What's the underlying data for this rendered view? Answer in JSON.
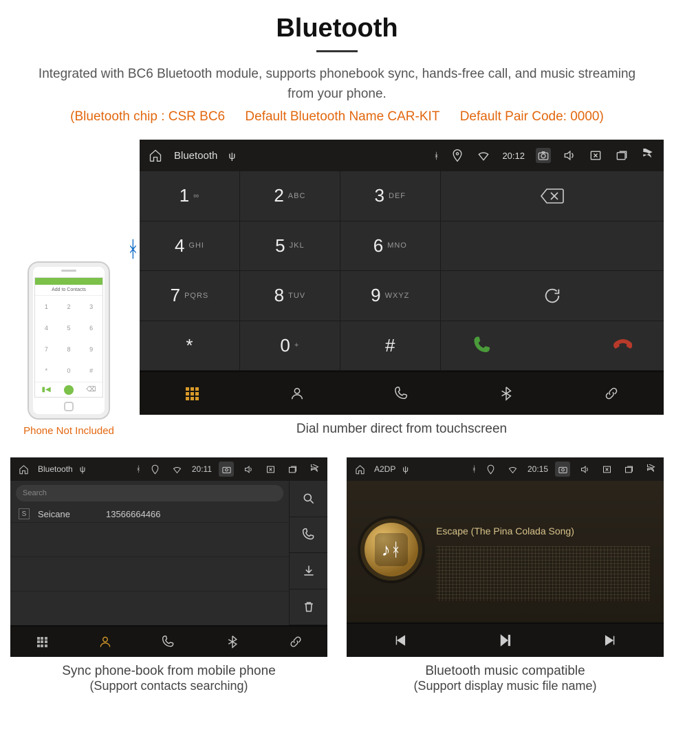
{
  "header": {
    "title": "Bluetooth",
    "subtitle": "Integrated with BC6 Bluetooth module, supports phonebook sync, hands-free call, and music streaming from your phone.",
    "hint_chip": "(Bluetooth chip : CSR BC6",
    "hint_name": "Default Bluetooth Name CAR-KIT",
    "hint_code": "Default Pair Code: 0000)"
  },
  "phone": {
    "add_to_contacts": "Add to Contacts",
    "keys": [
      "1",
      "2",
      "3",
      "4",
      "5",
      "6",
      "7",
      "8",
      "9",
      "*",
      "0",
      "#"
    ],
    "not_included": "Phone Not Included"
  },
  "dialer": {
    "topbar": {
      "title": "Bluetooth",
      "time": "20:12"
    },
    "keys": [
      {
        "n": "1",
        "l": "∞"
      },
      {
        "n": "2",
        "l": "ABC"
      },
      {
        "n": "3",
        "l": "DEF"
      },
      {
        "n": "4",
        "l": "GHI"
      },
      {
        "n": "5",
        "l": "JKL"
      },
      {
        "n": "6",
        "l": "MNO"
      },
      {
        "n": "7",
        "l": "PQRS"
      },
      {
        "n": "8",
        "l": "TUV"
      },
      {
        "n": "9",
        "l": "WXYZ"
      },
      {
        "n": "*",
        "l": ""
      },
      {
        "n": "0",
        "l": "+"
      },
      {
        "n": "#",
        "l": ""
      }
    ],
    "caption": "Dial number direct from touchscreen"
  },
  "phonebook": {
    "topbar": {
      "title": "Bluetooth",
      "time": "20:11"
    },
    "search_placeholder": "Search",
    "contact": {
      "badge": "S",
      "name": "Seicane",
      "number": "13566664466"
    },
    "caption_line1": "Sync phone-book from mobile phone",
    "caption_line2": "(Support contacts searching)"
  },
  "music": {
    "topbar": {
      "title": "A2DP",
      "time": "20:15"
    },
    "track": "Escape (The Pina Colada Song)",
    "caption_line1": "Bluetooth music compatible",
    "caption_line2": "(Support display music file name)"
  }
}
